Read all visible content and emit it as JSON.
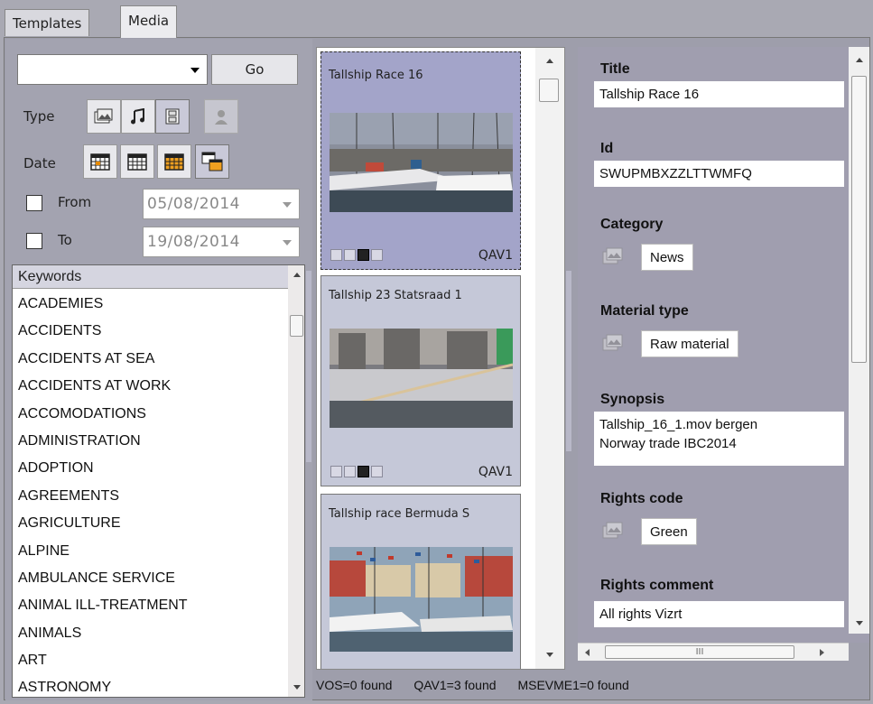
{
  "tabs": [
    {
      "label": "Templates"
    },
    {
      "label": "Media"
    }
  ],
  "filters": {
    "search_value": "",
    "go_label": "Go",
    "type_label": "Type",
    "date_label": "Date",
    "from_label": "From",
    "to_label": "To",
    "from_date": "05/08/2014",
    "to_date": "19/08/2014"
  },
  "keywords": {
    "header": "Keywords",
    "items": [
      "ACADEMIES",
      "ACCIDENTS",
      "ACCIDENTS AT SEA",
      "ACCIDENTS AT WORK",
      "ACCOMODATIONS",
      "ADMINISTRATION",
      "ADOPTION",
      "AGREEMENTS",
      "AGRICULTURE",
      "ALPINE",
      "AMBULANCE SERVICE",
      "ANIMAL ILL-TREATMENT",
      "ANIMALS",
      "ART",
      "ASTRONOMY"
    ]
  },
  "results": [
    {
      "title": "Tallship Race 16",
      "source": "QAV1",
      "selected": true
    },
    {
      "title": "Tallship 23 Statsraad 1",
      "source": "QAV1",
      "selected": false
    },
    {
      "title": "Tallship race Bermuda S",
      "source": "",
      "selected": false
    }
  ],
  "details": {
    "title_label": "Title",
    "title_value": "Tallship Race 16",
    "id_label": "Id",
    "id_value": "SWUPMBXZZLTTWMFQ",
    "category_label": "Category",
    "category_value": "News",
    "material_label": "Material type",
    "material_value": "Raw material",
    "synopsis_label": "Synopsis",
    "synopsis_line1": "Tallship_16_1.mov bergen",
    "synopsis_line2": "Norway trade IBC2014",
    "rights_code_label": "Rights code",
    "rights_code_value": "Green",
    "rights_comment_label": "Rights comment",
    "rights_comment_value": "All rights Vizrt",
    "hscroll_grip": "III"
  },
  "status": {
    "vos": "VOS=0 found",
    "qav1": "QAV1=3 found",
    "msevme1": "MSEVME1=0 found"
  },
  "colors": {
    "selected_card": "#a3a4c9",
    "card": "#c5c8d8",
    "panel": "#a09eaf"
  }
}
